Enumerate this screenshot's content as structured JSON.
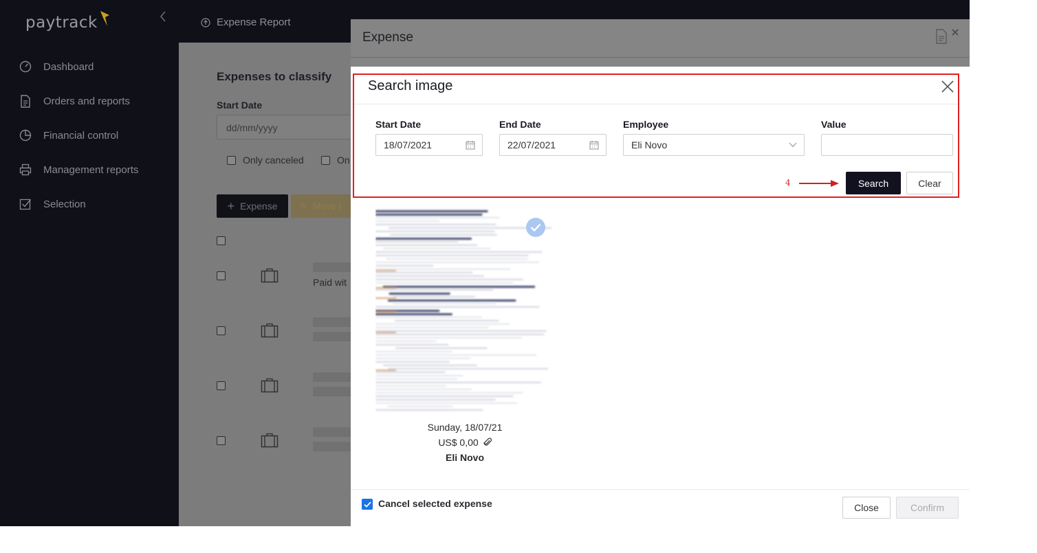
{
  "app": {
    "logo_text": "paytrack"
  },
  "sidebar": {
    "items": [
      {
        "label": "Dashboard",
        "icon": "gauge-icon"
      },
      {
        "label": "Orders and reports",
        "icon": "document-icon"
      },
      {
        "label": "Financial control",
        "icon": "pie-chart-icon"
      },
      {
        "label": "Management reports",
        "icon": "printer-icon"
      },
      {
        "label": "Selection",
        "icon": "checkbox-icon"
      }
    ]
  },
  "topbar": {
    "breadcrumb": "Expense Report"
  },
  "background_page": {
    "heading": "Expenses to classify",
    "start_date_label": "Start Date",
    "start_date_placeholder": "dd/mm/yyyy",
    "only_canceled": "Only canceled",
    "second_filter_partial": "On",
    "add_expense": "Expense",
    "move_partial": "Move t",
    "paid_partial": "Paid wit"
  },
  "expense_modal": {
    "title": "Expense"
  },
  "search_image": {
    "title": "Search image",
    "start_date": {
      "label": "Start Date",
      "value": "18/07/2021"
    },
    "end_date": {
      "label": "End Date",
      "value": "22/07/2021"
    },
    "employee": {
      "label": "Employee",
      "value": "Eli Novo"
    },
    "value_field": {
      "label": "Value",
      "value": ""
    },
    "search_button": "Search",
    "clear_button": "Clear",
    "step_number": "4"
  },
  "result_card": {
    "date": "Sunday, 18/07/21",
    "value": "US$ 0,00",
    "employee": "Eli Novo",
    "selected": true
  },
  "footer": {
    "cancel_selected_label": "Cancel selected expense",
    "cancel_selected_checked": true,
    "close_button": "Close",
    "confirm_button": "Confirm"
  },
  "colors": {
    "sidebar_bg": "#101019",
    "highlight_border": "#e01f1f",
    "primary_button": "#111120",
    "checkbox_blue": "#1a73e8"
  }
}
